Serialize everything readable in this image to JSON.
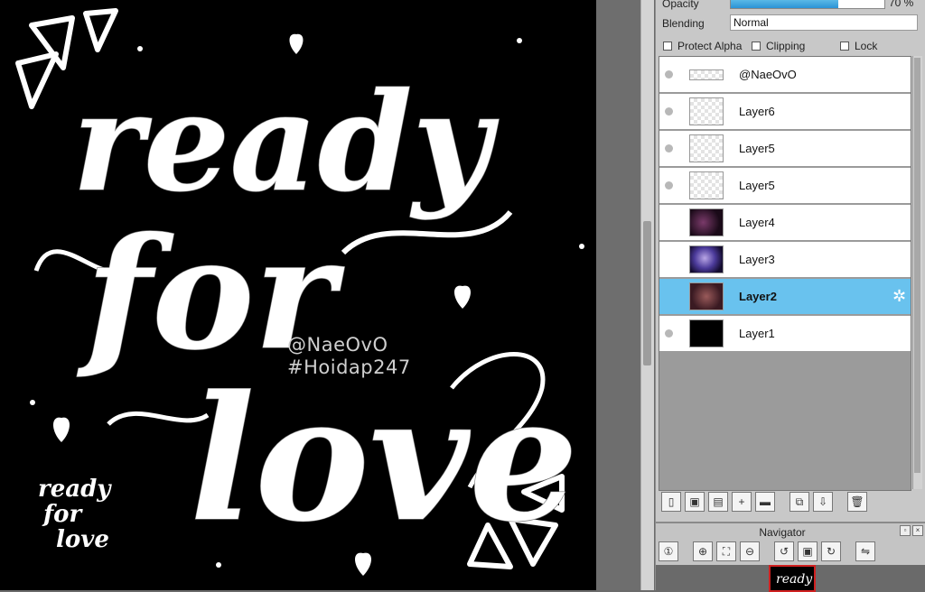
{
  "canvas": {
    "lettering": [
      "ready",
      "for",
      "love"
    ],
    "watermark": [
      "@NaeOvO",
      "#Hoidap247"
    ],
    "small_lettering": [
      "ready",
      "for",
      "love"
    ]
  },
  "properties": {
    "opacity_label": "Opacity",
    "opacity_value": "70 %",
    "opacity_percent": 70,
    "blending_label": "Blending",
    "blending_value": "Normal",
    "protect_alpha": "Protect Alpha",
    "clipping": "Clipping",
    "lock": "Lock"
  },
  "layers": [
    {
      "name": "@NaeOvO",
      "thumb": "trans thin",
      "visible": true,
      "selected": false
    },
    {
      "name": "Layer6",
      "thumb": "trans",
      "visible": true,
      "selected": false
    },
    {
      "name": "Layer5",
      "thumb": "trans",
      "visible": true,
      "selected": false
    },
    {
      "name": "Layer5",
      "thumb": "trans",
      "visible": true,
      "selected": false
    },
    {
      "name": "Layer4",
      "thumb": "img1",
      "visible": false,
      "selected": false
    },
    {
      "name": "Layer3",
      "thumb": "img2",
      "visible": false,
      "selected": false
    },
    {
      "name": "Layer2",
      "thumb": "img3",
      "visible": false,
      "selected": true
    },
    {
      "name": "Layer1",
      "thumb": "black",
      "visible": true,
      "selected": false
    }
  ],
  "navigator": {
    "title": "Navigator"
  },
  "colors": {
    "selected_layer": "#69c2ee",
    "canvas_bg": "#000000",
    "nav_frame": "#d02020"
  }
}
